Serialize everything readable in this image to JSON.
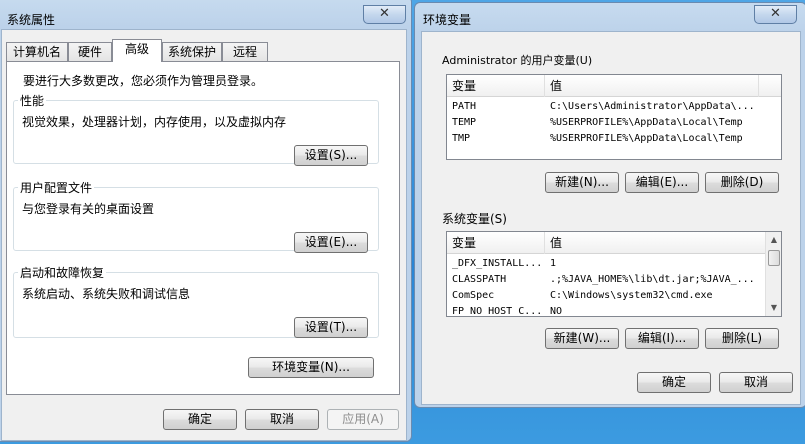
{
  "sys": {
    "title": "系统属性",
    "close": "✕",
    "tabs": [
      "计算机名",
      "硬件",
      "高级",
      "系统保护",
      "远程"
    ],
    "notice": "要进行大多数更改，您必须作为管理员登录。",
    "perf": {
      "label": "性能",
      "desc": "视觉效果，处理器计划，内存使用，以及虚拟内存",
      "btn": "设置(S)..."
    },
    "profile": {
      "label": "用户配置文件",
      "desc": "与您登录有关的桌面设置",
      "btn": "设置(E)..."
    },
    "startup": {
      "label": "启动和故障恢复",
      "desc": "系统启动、系统失败和调试信息",
      "btn": "设置(T)..."
    },
    "envbtn": "环境变量(N)...",
    "ok": "确定",
    "cancel": "取消",
    "apply": "应用(A)"
  },
  "env": {
    "title": "环境变量",
    "close": "✕",
    "user_label": "Administrator 的用户变量(U)",
    "col_var": "变量",
    "col_val": "值",
    "user_vars": [
      {
        "name": "PATH",
        "value": "C:\\Users\\Administrator\\AppData\\..."
      },
      {
        "name": "TEMP",
        "value": "%USERPROFILE%\\AppData\\Local\\Temp"
      },
      {
        "name": "TMP",
        "value": "%USERPROFILE%\\AppData\\Local\\Temp"
      }
    ],
    "user_new": "新建(N)...",
    "user_edit": "编辑(E)...",
    "user_del": "删除(D)",
    "sys_label": "系统变量(S)",
    "sys_vars": [
      {
        "name": "_DFX_INSTALL...",
        "value": "1"
      },
      {
        "name": "CLASSPATH",
        "value": ".;%JAVA_HOME%\\lib\\dt.jar;%JAVA_..."
      },
      {
        "name": "ComSpec",
        "value": "C:\\Windows\\system32\\cmd.exe"
      },
      {
        "name": "FP_NO_HOST_C...",
        "value": "NO"
      }
    ],
    "sys_new": "新建(W)...",
    "sys_edit": "编辑(I)...",
    "sys_del": "删除(L)",
    "ok": "确定",
    "cancel": "取消"
  }
}
